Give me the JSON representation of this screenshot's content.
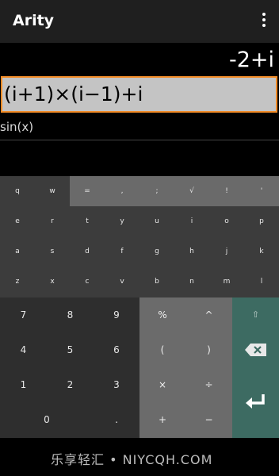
{
  "appbar": {
    "title": "Arity",
    "menu_icon": "overflow-menu-icon"
  },
  "display": {
    "result": "-2+i",
    "input": "(i+1)×(i−1)+i",
    "history": "sin(x)"
  },
  "keyboard": {
    "fn_row": [
      "q",
      "w",
      "=",
      ",",
      ";",
      "√",
      "!",
      "'"
    ],
    "alpha_rows": [
      [
        "e",
        "r",
        "t",
        "y",
        "u",
        "i",
        "o",
        "p"
      ],
      [
        "a",
        "s",
        "d",
        "f",
        "g",
        "h",
        "j",
        "k"
      ],
      [
        "z",
        "x",
        "c",
        "v",
        "b",
        "n",
        "m",
        "l"
      ]
    ],
    "num_rows": [
      [
        "7",
        "8",
        "9"
      ],
      [
        "4",
        "5",
        "6"
      ],
      [
        "1",
        "2",
        "3"
      ],
      [
        "0",
        "."
      ]
    ],
    "op_rows": [
      [
        "%",
        "^"
      ],
      [
        "(",
        ")"
      ],
      [
        "×",
        "÷"
      ],
      [
        "+",
        "−"
      ]
    ],
    "actions": {
      "shift": "⇧",
      "backspace_icon": "backspace-icon",
      "enter_icon": "enter-icon"
    }
  },
  "watermark": "乐享轻汇 • NIYCQH.COM"
}
